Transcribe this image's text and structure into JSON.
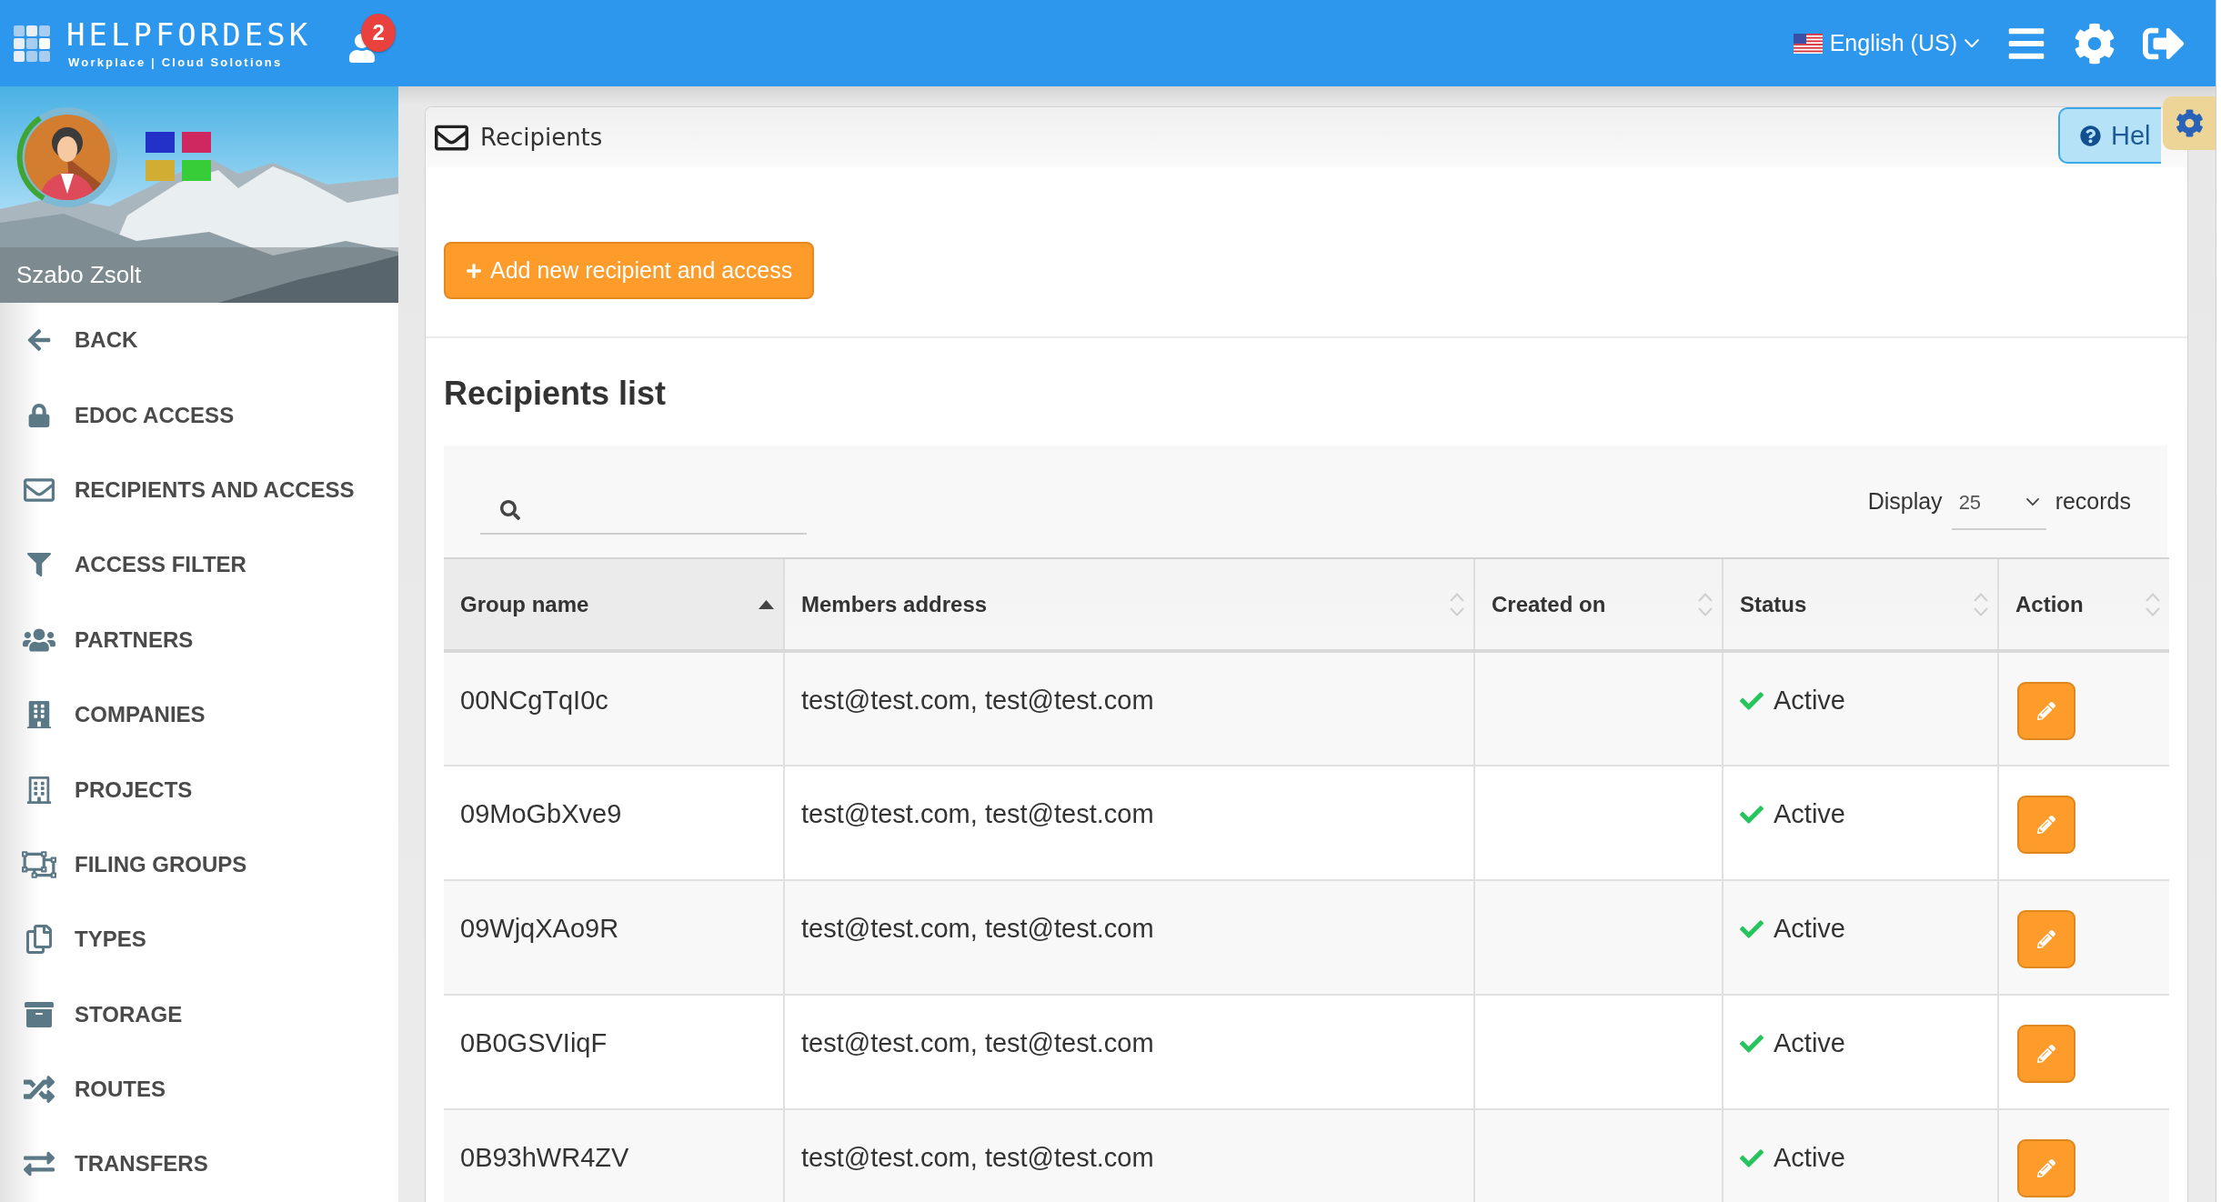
{
  "topbar": {
    "logo_title": "HELPFORDESK",
    "logo_subtitle": "Workplace | Cloud Solotions",
    "notification_count": "2",
    "language": "English (US)"
  },
  "sidebar": {
    "user_name": "Szabo Zsolt",
    "items": [
      {
        "label": "BACK"
      },
      {
        "label": "EDOC ACCESS"
      },
      {
        "label": "RECIPIENTS AND ACCESS"
      },
      {
        "label": "ACCESS FILTER"
      },
      {
        "label": "PARTNERS"
      },
      {
        "label": "COMPANIES"
      },
      {
        "label": "PROJECTS"
      },
      {
        "label": "FILING GROUPS"
      },
      {
        "label": "TYPES"
      },
      {
        "label": "STORAGE"
      },
      {
        "label": "ROUTES"
      },
      {
        "label": "TRANSFERS"
      }
    ]
  },
  "panel": {
    "title": "Recipients",
    "help_button": "Hel",
    "add_button": "Add new recipient and access"
  },
  "recipients_list": {
    "title": "Recipients list",
    "display_label": "Display",
    "page_size": "25",
    "records_label": "records",
    "columns": [
      {
        "label": "Group name",
        "sorted": true
      },
      {
        "label": "Members address",
        "sorted": false
      },
      {
        "label": "Created on",
        "sorted": false
      },
      {
        "label": "Status",
        "sorted": false
      },
      {
        "label": "Action",
        "sorted": false
      }
    ],
    "rows": [
      {
        "group_name": "00NCgTqI0c",
        "members_address": "test@test.com, test@test.com",
        "status": "Active",
        "active": true
      },
      {
        "group_name": "09MoGbXve9",
        "members_address": "test@test.com, test@test.com",
        "status": "Active",
        "active": true
      },
      {
        "group_name": "09WjqXAo9R",
        "members_address": "test@test.com, test@test.com",
        "status": "Active",
        "active": true
      },
      {
        "group_name": "0B0GSVIiqF",
        "members_address": "test@test.com, test@test.com",
        "status": "Active",
        "active": true
      },
      {
        "group_name": "0B93hWR4ZV",
        "members_address": "test@test.com, test@test.com",
        "status": "Active",
        "active": true
      }
    ]
  }
}
